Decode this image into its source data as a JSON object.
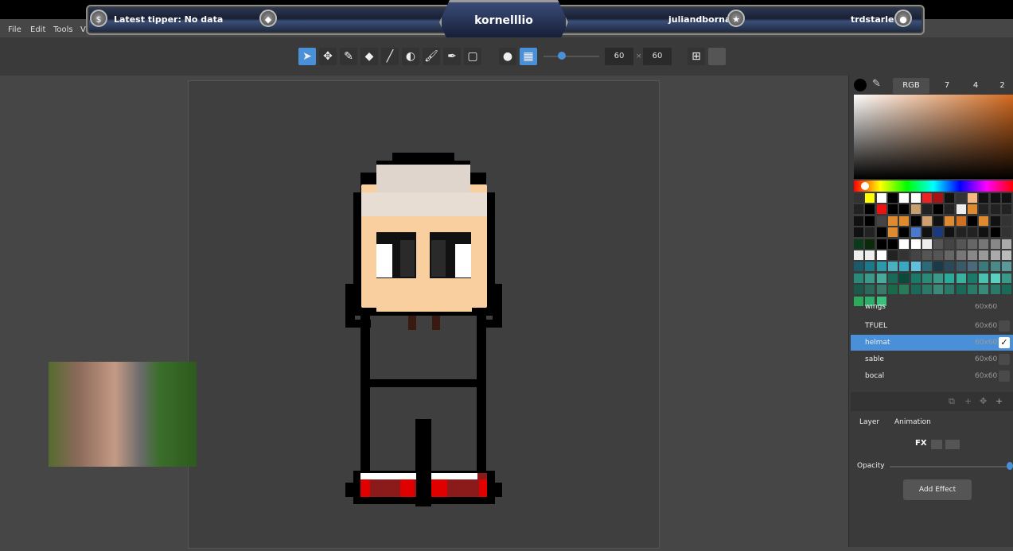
{
  "stream": {
    "latest_tipper": "Latest tipper: No data",
    "channel": "kornelllio",
    "right_name_1": "juliandbornal",
    "right_name_2": "trdstarlet"
  },
  "menu": {
    "file": "File",
    "edit": "Edit",
    "tools": "Tools",
    "view": "V"
  },
  "toolbar": {
    "brush_size_w": "60",
    "brush_size_h": "60"
  },
  "color_panel": {
    "mode": "RGB",
    "tab2": "7",
    "tab3": "4",
    "tab4": "2"
  },
  "layers": [
    {
      "name": "wings",
      "size": "60x60",
      "selected": false
    },
    {
      "name": "TFUEL",
      "size": "60x60",
      "selected": false
    },
    {
      "name": "helmat",
      "size": "60x60",
      "selected": true
    },
    {
      "name": "sable",
      "size": "60x60",
      "selected": false
    },
    {
      "name": "bocal",
      "size": "60x60",
      "selected": false
    }
  ],
  "properties": {
    "tab_layer": "Layer",
    "tab_animation": "Animation",
    "opacity_label": "Opacity",
    "add_effect": "Add Effect",
    "opacity": 1.0
  },
  "colors": {
    "accent": "#4a90d9",
    "skin": "#f9cfa0",
    "hair": "#e0d5cc",
    "shoe_red": "#e10000",
    "shoe_dark": "#8b1a1a"
  }
}
